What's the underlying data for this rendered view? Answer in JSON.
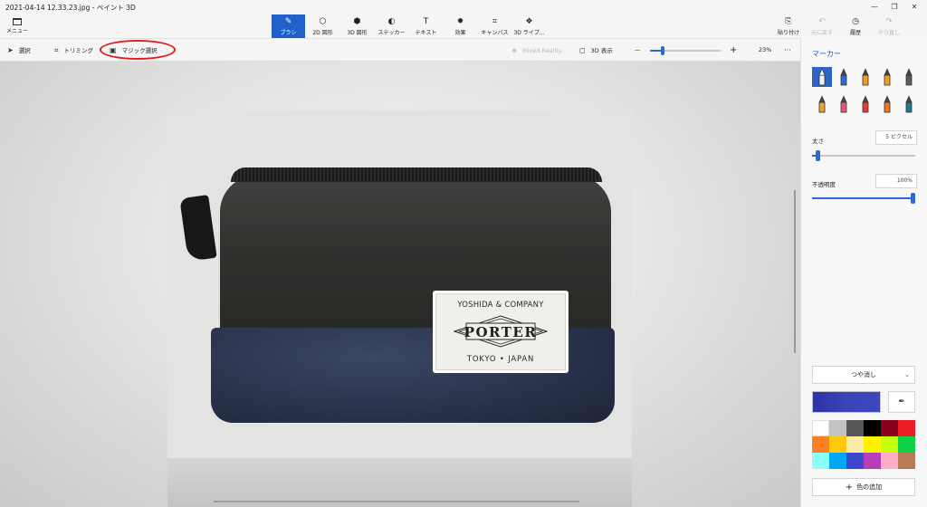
{
  "window": {
    "title": "2021-04-14 12.33.23.jpg - ペイント 3D",
    "minimize": "—",
    "maximize": "❐",
    "close": "✕"
  },
  "toolbar": {
    "menu_label": "メニュー",
    "tools": [
      {
        "label": "ブラシ",
        "icon": "brush-icon",
        "glyph": "✎",
        "active": true
      },
      {
        "label": "2D 図形",
        "icon": "shapes-2d-icon",
        "glyph": "⬡",
        "active": false
      },
      {
        "label": "3D 図形",
        "icon": "cube-icon",
        "glyph": "⬢",
        "active": false
      },
      {
        "label": "ステッカー",
        "icon": "sticker-icon",
        "glyph": "◐",
        "active": false
      },
      {
        "label": "テキスト",
        "icon": "text-icon",
        "glyph": "T",
        "active": false
      },
      {
        "label": "効果",
        "icon": "effects-icon",
        "glyph": "✹",
        "active": false
      },
      {
        "label": "キャンバス",
        "icon": "canvas-icon",
        "glyph": "⌗",
        "active": false
      },
      {
        "label": "3D ライブ...",
        "icon": "library-3d-icon",
        "glyph": "❖",
        "active": false
      }
    ],
    "right_tools": [
      {
        "label": "貼り付け",
        "icon": "paste-icon",
        "glyph": "⎘",
        "disabled": false
      },
      {
        "label": "元に戻す",
        "icon": "undo-icon",
        "glyph": "↶",
        "disabled": true
      },
      {
        "label": "履歴",
        "icon": "history-icon",
        "glyph": "◷",
        "disabled": false
      },
      {
        "label": "やり直し",
        "icon": "redo-icon",
        "glyph": "↷",
        "disabled": true
      }
    ]
  },
  "subbar": {
    "select": "選択",
    "crop": "トリミング",
    "magic_select": "マジック選択",
    "mixed_reality": "Mixed Reality",
    "view_3d": "3D 表示",
    "zoom_minus": "—",
    "zoom_plus": "+",
    "zoom_level": "23%",
    "zoom_fraction": 0.18,
    "more": "···"
  },
  "photo": {
    "label_top": "YOSHIDA & COMPANY",
    "label_brand": "PORTER",
    "label_bottom": "TOKYO • JAPAN"
  },
  "panel": {
    "title": "マーカー",
    "brushes": [
      {
        "name": "marker-icon",
        "color": "#f0f0f0",
        "selected": true
      },
      {
        "name": "calligraphy-pen-icon",
        "color": "#2f6bd1",
        "selected": false
      },
      {
        "name": "oil-brush-icon",
        "color": "#f0a020",
        "selected": false
      },
      {
        "name": "watercolor-icon",
        "color": "#f2a01e",
        "selected": false
      },
      {
        "name": "pixel-pen-icon",
        "color": "#5a5a5a",
        "selected": false
      },
      {
        "name": "pencil-icon",
        "color": "#e2a633",
        "selected": false
      },
      {
        "name": "eraser-icon",
        "color": "#e4557a",
        "selected": false
      },
      {
        "name": "crayon-icon",
        "color": "#e43b3b",
        "selected": false
      },
      {
        "name": "spray-can-icon",
        "color": "#f07a22",
        "selected": false
      },
      {
        "name": "fill-bucket-icon",
        "color": "#1f7a8c",
        "selected": false
      }
    ],
    "thickness_label": "太さ",
    "thickness_value": "5 ピクセル",
    "thickness_fraction": 0.05,
    "opacity_label": "不透明度",
    "opacity_value": "100%",
    "opacity_fraction": 1.0,
    "finish": "つや消し",
    "current_color": "#3a44b8",
    "swatches": [
      "#ffffff",
      "#c3c3c3",
      "#585858",
      "#000000",
      "#88001b",
      "#ec1c24",
      "#ff7f27",
      "#ffc90e",
      "#fdeca6",
      "#fff200",
      "#c4ff0e",
      "#0ed145",
      "#8cfffb",
      "#00a8f3",
      "#3f48cc",
      "#b83dba",
      "#ffaec8",
      "#b97a56"
    ],
    "add_color": "色の追加"
  }
}
